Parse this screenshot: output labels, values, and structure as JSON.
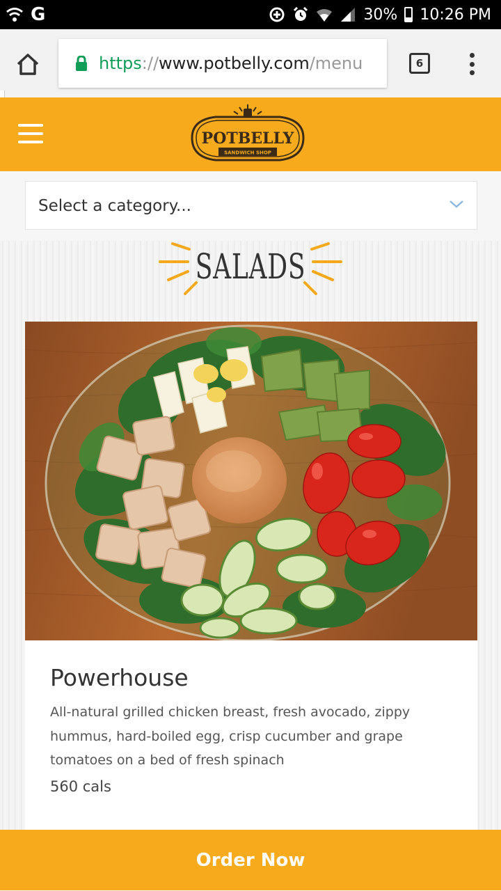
{
  "status_bar": {
    "icons_left": [
      "vpn-icon",
      "google-icon"
    ],
    "google_letter": "G",
    "icons_right": [
      "data-saver-icon",
      "alarm-icon",
      "wifi-icon",
      "signal-icon",
      "battery-icon"
    ],
    "battery": "30%",
    "time": "10:26 PM"
  },
  "browser": {
    "url_scheme": "https",
    "url_sep": "://",
    "url_host": "www.potbelly.com",
    "url_path": "/menu",
    "tab_count": "6"
  },
  "header": {
    "logo_text": "POTBELLY",
    "logo_subtext": "SANDWICH SHOP",
    "brand_color": "#f7ab1c"
  },
  "category": {
    "placeholder": "Select a category..."
  },
  "section": {
    "title": "SALADS"
  },
  "item": {
    "name": "Powerhouse",
    "description": "All-natural grilled chicken breast, fresh avocado, zippy hummus, hard-boiled egg, crisp cucumber and grape tomatoes on a bed of fresh spinach",
    "calories": "560 cals"
  },
  "order_button": {
    "label": "Order Now"
  }
}
